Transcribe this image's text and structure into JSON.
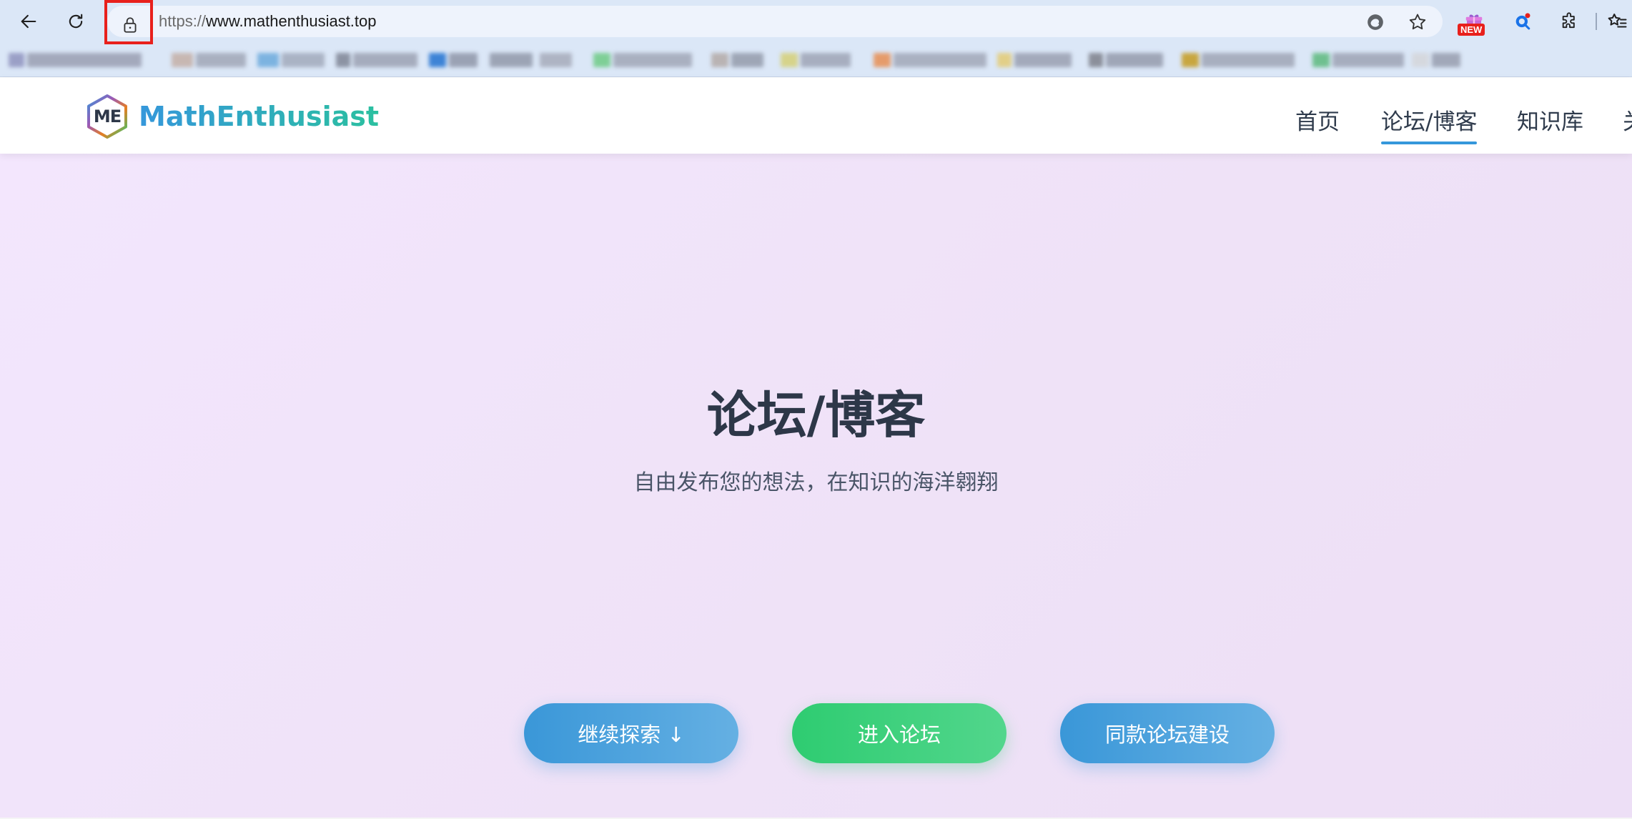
{
  "browser": {
    "url_protocol": "https://",
    "url_host": "www.mathenthusiast.top",
    "new_badge": "NEW",
    "icons": {
      "back": "back-arrow-icon",
      "reload": "reload-icon",
      "lock": "lock-icon",
      "read_aloud": "edge-read-icon",
      "favorite": "star-icon",
      "extension_new": "gift-extension-icon",
      "search_ext": "search-extension-icon",
      "extensions": "puzzle-icon",
      "favorites_menu": "favorites-list-icon"
    }
  },
  "site": {
    "logo_mark": "ME",
    "logo_text": "MathEnthusiast",
    "nav": [
      {
        "label": "首页"
      },
      {
        "label": "论坛/博客",
        "active": true
      },
      {
        "label": "知识库"
      },
      {
        "label": "关"
      }
    ]
  },
  "hero": {
    "title": "论坛/博客",
    "subtitle": "自由发布您的想法，在知识的海洋翱翔",
    "buttons": {
      "explore": "继续探索 ↓",
      "forum": "进入论坛",
      "build": "同款论坛建设"
    }
  },
  "colors": {
    "accent_blue": "#3597db",
    "accent_green": "#2ecc71",
    "highlight_red": "#e8201c",
    "hero_bg": "#f1e4fa"
  }
}
